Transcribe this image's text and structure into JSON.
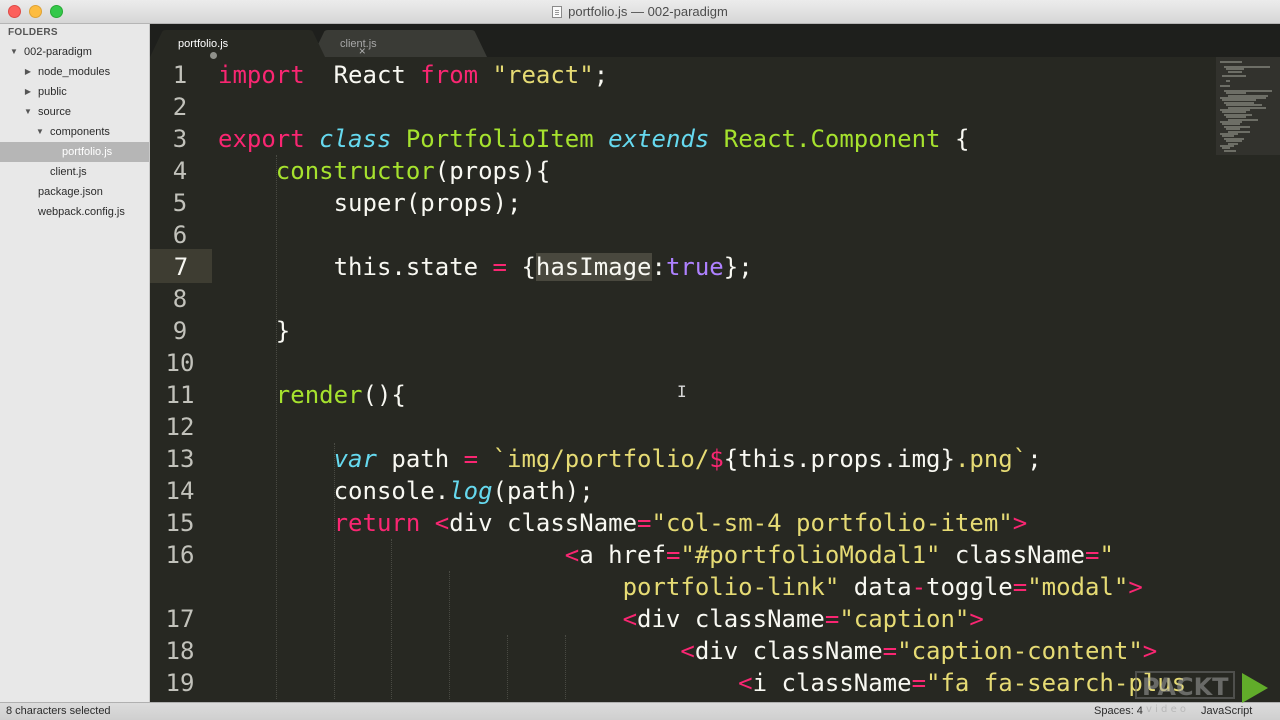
{
  "window": {
    "title": "portfolio.js — 002-paradigm"
  },
  "sidebar": {
    "header": "FOLDERS",
    "items": [
      {
        "label": "002-paradigm",
        "depth": 0,
        "arrow": "open"
      },
      {
        "label": "node_modules",
        "depth": 1,
        "arrow": "closed"
      },
      {
        "label": "public",
        "depth": 1,
        "arrow": "closed"
      },
      {
        "label": "source",
        "depth": 1,
        "arrow": "open"
      },
      {
        "label": "components",
        "depth": 2,
        "arrow": "open"
      },
      {
        "label": "portfolio.js",
        "depth": 3,
        "arrow": "none",
        "selected": true
      },
      {
        "label": "client.js",
        "depth": 2,
        "arrow": "none"
      },
      {
        "label": "package.json",
        "depth": 1,
        "arrow": "none"
      },
      {
        "label": "webpack.config.js",
        "depth": 1,
        "arrow": "none"
      }
    ]
  },
  "tabs": [
    {
      "label": "portfolio.js",
      "active": true,
      "dirty": true
    },
    {
      "label": "client.js",
      "active": false,
      "dirty": false,
      "close": "×"
    }
  ],
  "editor": {
    "current_line": 7,
    "line_numbers": [
      "1",
      "2",
      "3",
      "4",
      "5",
      "6",
      "7",
      "8",
      "9",
      "10",
      "11",
      "12",
      "13",
      "14",
      "15",
      "16",
      "",
      "17",
      "18",
      "19"
    ],
    "lines": [
      [
        [
          "k",
          "import"
        ],
        [
          "",
          "  React "
        ],
        [
          "k",
          "from"
        ],
        [
          "",
          " "
        ],
        [
          "s",
          "\"react\""
        ],
        [
          "",
          ";"
        ]
      ],
      [],
      [
        [
          "k",
          "export"
        ],
        [
          "",
          " "
        ],
        [
          "i",
          "class"
        ],
        [
          "",
          " "
        ],
        [
          "g",
          "PortfolioItem"
        ],
        [
          "",
          " "
        ],
        [
          "i",
          "extends"
        ],
        [
          "",
          ""
        ],
        [
          "g",
          " React.Component"
        ],
        [
          "",
          " {"
        ]
      ],
      [
        [
          "",
          "    "
        ],
        [
          "g",
          "constructor"
        ],
        [
          "",
          "(props){"
        ]
      ],
      [
        [
          "",
          "        super(props);"
        ]
      ],
      [],
      [
        [
          "",
          "        this.state "
        ],
        [
          "k",
          "="
        ],
        [
          "",
          " {"
        ],
        [
          "sel",
          "hasImage"
        ],
        [
          "",
          ":"
        ],
        [
          "p",
          "true"
        ],
        [
          "",
          "};"
        ]
      ],
      [],
      [
        [
          "",
          "    }"
        ]
      ],
      [],
      [
        [
          "",
          "    "
        ],
        [
          "g",
          "render"
        ],
        [
          "",
          "(){"
        ]
      ],
      [],
      [
        [
          "",
          "        "
        ],
        [
          "i",
          "var"
        ],
        [
          "",
          " path "
        ],
        [
          "k",
          "="
        ],
        [
          "",
          " "
        ],
        [
          "s",
          "`img/portfolio/"
        ],
        [
          "k",
          "$"
        ],
        [
          "",
          "{this.props.img}"
        ],
        [
          "s",
          ".png`"
        ],
        [
          "",
          ";"
        ]
      ],
      [
        [
          "",
          "        console."
        ],
        [
          "i",
          "log"
        ],
        [
          "",
          "(path);"
        ]
      ],
      [
        [
          "",
          "        "
        ],
        [
          "k",
          "return"
        ],
        [
          "",
          " "
        ],
        [
          "k",
          "<"
        ],
        [
          "",
          "div className"
        ],
        [
          "k",
          "="
        ],
        [
          "s",
          "\"col-sm-4 portfolio-item\""
        ],
        [
          "k",
          ">"
        ]
      ],
      [
        [
          "",
          "                        "
        ],
        [
          "k",
          "<"
        ],
        [
          "",
          "a href"
        ],
        [
          "k",
          "="
        ],
        [
          "s",
          "\"#portfolioModal1\""
        ],
        [
          "",
          " className"
        ],
        [
          "k",
          "="
        ],
        [
          "s",
          "\""
        ]
      ],
      [
        [
          "",
          "                            "
        ],
        [
          "s",
          "portfolio-link\""
        ],
        [
          "",
          " data"
        ],
        [
          "k",
          "-"
        ],
        [
          "",
          "toggle"
        ],
        [
          "k",
          "="
        ],
        [
          "s",
          "\"modal\""
        ],
        [
          "k",
          ">"
        ]
      ],
      [
        [
          "",
          "                            "
        ],
        [
          "k",
          "<"
        ],
        [
          "",
          "div className"
        ],
        [
          "k",
          "="
        ],
        [
          "s",
          "\"caption\""
        ],
        [
          "k",
          ">"
        ]
      ],
      [
        [
          "",
          "                                "
        ],
        [
          "k",
          "<"
        ],
        [
          "",
          "div className"
        ],
        [
          "k",
          "="
        ],
        [
          "s",
          "\"caption-content\""
        ],
        [
          "k",
          ">"
        ]
      ],
      [
        [
          "",
          "                                    "
        ],
        [
          "k",
          "<"
        ],
        [
          "",
          "i className"
        ],
        [
          "k",
          "="
        ],
        [
          "s",
          "\"fa fa-search-plus"
        ]
      ]
    ]
  },
  "status": {
    "left": "8 characters selected",
    "spaces": "Spaces: 4",
    "syntax": "JavaScript"
  },
  "watermark": {
    "text": "PACKT",
    "sub": "v i d e o"
  },
  "colors": {
    "background": "#272822",
    "keyword": "#f92672",
    "string": "#e6db74",
    "storage": "#66d9ef",
    "entity": "#a6e22e",
    "constant": "#ae81ff"
  }
}
